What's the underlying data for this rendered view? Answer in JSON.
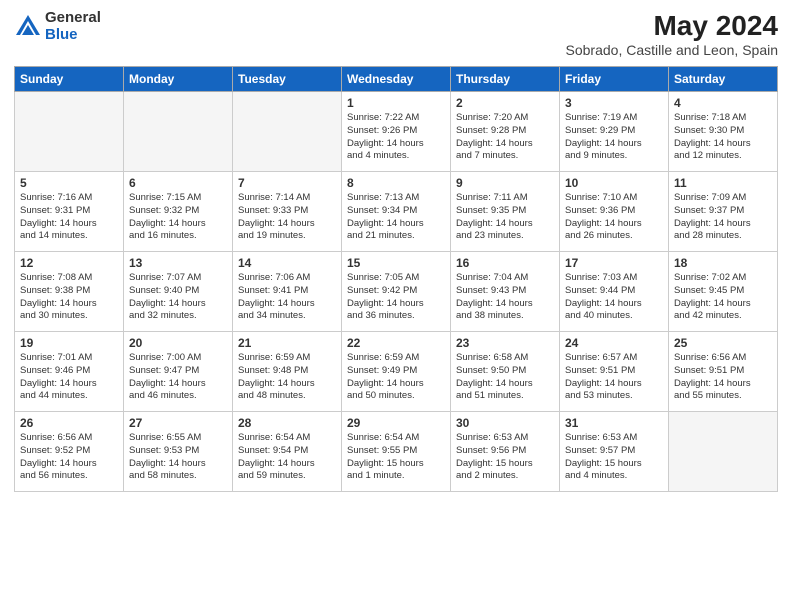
{
  "header": {
    "logo_general": "General",
    "logo_blue": "Blue",
    "month_title": "May 2024",
    "location": "Sobrado, Castille and Leon, Spain"
  },
  "weekdays": [
    "Sunday",
    "Monday",
    "Tuesday",
    "Wednesday",
    "Thursday",
    "Friday",
    "Saturday"
  ],
  "weeks": [
    [
      {
        "day": "",
        "empty": true
      },
      {
        "day": "",
        "empty": true
      },
      {
        "day": "",
        "empty": true
      },
      {
        "day": "1",
        "lines": [
          "Sunrise: 7:22 AM",
          "Sunset: 9:26 PM",
          "Daylight: 14 hours",
          "and 4 minutes."
        ]
      },
      {
        "day": "2",
        "lines": [
          "Sunrise: 7:20 AM",
          "Sunset: 9:28 PM",
          "Daylight: 14 hours",
          "and 7 minutes."
        ]
      },
      {
        "day": "3",
        "lines": [
          "Sunrise: 7:19 AM",
          "Sunset: 9:29 PM",
          "Daylight: 14 hours",
          "and 9 minutes."
        ]
      },
      {
        "day": "4",
        "lines": [
          "Sunrise: 7:18 AM",
          "Sunset: 9:30 PM",
          "Daylight: 14 hours",
          "and 12 minutes."
        ]
      }
    ],
    [
      {
        "day": "5",
        "lines": [
          "Sunrise: 7:16 AM",
          "Sunset: 9:31 PM",
          "Daylight: 14 hours",
          "and 14 minutes."
        ]
      },
      {
        "day": "6",
        "lines": [
          "Sunrise: 7:15 AM",
          "Sunset: 9:32 PM",
          "Daylight: 14 hours",
          "and 16 minutes."
        ]
      },
      {
        "day": "7",
        "lines": [
          "Sunrise: 7:14 AM",
          "Sunset: 9:33 PM",
          "Daylight: 14 hours",
          "and 19 minutes."
        ]
      },
      {
        "day": "8",
        "lines": [
          "Sunrise: 7:13 AM",
          "Sunset: 9:34 PM",
          "Daylight: 14 hours",
          "and 21 minutes."
        ]
      },
      {
        "day": "9",
        "lines": [
          "Sunrise: 7:11 AM",
          "Sunset: 9:35 PM",
          "Daylight: 14 hours",
          "and 23 minutes."
        ]
      },
      {
        "day": "10",
        "lines": [
          "Sunrise: 7:10 AM",
          "Sunset: 9:36 PM",
          "Daylight: 14 hours",
          "and 26 minutes."
        ]
      },
      {
        "day": "11",
        "lines": [
          "Sunrise: 7:09 AM",
          "Sunset: 9:37 PM",
          "Daylight: 14 hours",
          "and 28 minutes."
        ]
      }
    ],
    [
      {
        "day": "12",
        "lines": [
          "Sunrise: 7:08 AM",
          "Sunset: 9:38 PM",
          "Daylight: 14 hours",
          "and 30 minutes."
        ]
      },
      {
        "day": "13",
        "lines": [
          "Sunrise: 7:07 AM",
          "Sunset: 9:40 PM",
          "Daylight: 14 hours",
          "and 32 minutes."
        ]
      },
      {
        "day": "14",
        "lines": [
          "Sunrise: 7:06 AM",
          "Sunset: 9:41 PM",
          "Daylight: 14 hours",
          "and 34 minutes."
        ]
      },
      {
        "day": "15",
        "lines": [
          "Sunrise: 7:05 AM",
          "Sunset: 9:42 PM",
          "Daylight: 14 hours",
          "and 36 minutes."
        ]
      },
      {
        "day": "16",
        "lines": [
          "Sunrise: 7:04 AM",
          "Sunset: 9:43 PM",
          "Daylight: 14 hours",
          "and 38 minutes."
        ]
      },
      {
        "day": "17",
        "lines": [
          "Sunrise: 7:03 AM",
          "Sunset: 9:44 PM",
          "Daylight: 14 hours",
          "and 40 minutes."
        ]
      },
      {
        "day": "18",
        "lines": [
          "Sunrise: 7:02 AM",
          "Sunset: 9:45 PM",
          "Daylight: 14 hours",
          "and 42 minutes."
        ]
      }
    ],
    [
      {
        "day": "19",
        "lines": [
          "Sunrise: 7:01 AM",
          "Sunset: 9:46 PM",
          "Daylight: 14 hours",
          "and 44 minutes."
        ]
      },
      {
        "day": "20",
        "lines": [
          "Sunrise: 7:00 AM",
          "Sunset: 9:47 PM",
          "Daylight: 14 hours",
          "and 46 minutes."
        ]
      },
      {
        "day": "21",
        "lines": [
          "Sunrise: 6:59 AM",
          "Sunset: 9:48 PM",
          "Daylight: 14 hours",
          "and 48 minutes."
        ]
      },
      {
        "day": "22",
        "lines": [
          "Sunrise: 6:59 AM",
          "Sunset: 9:49 PM",
          "Daylight: 14 hours",
          "and 50 minutes."
        ]
      },
      {
        "day": "23",
        "lines": [
          "Sunrise: 6:58 AM",
          "Sunset: 9:50 PM",
          "Daylight: 14 hours",
          "and 51 minutes."
        ]
      },
      {
        "day": "24",
        "lines": [
          "Sunrise: 6:57 AM",
          "Sunset: 9:51 PM",
          "Daylight: 14 hours",
          "and 53 minutes."
        ]
      },
      {
        "day": "25",
        "lines": [
          "Sunrise: 6:56 AM",
          "Sunset: 9:51 PM",
          "Daylight: 14 hours",
          "and 55 minutes."
        ]
      }
    ],
    [
      {
        "day": "26",
        "lines": [
          "Sunrise: 6:56 AM",
          "Sunset: 9:52 PM",
          "Daylight: 14 hours",
          "and 56 minutes."
        ]
      },
      {
        "day": "27",
        "lines": [
          "Sunrise: 6:55 AM",
          "Sunset: 9:53 PM",
          "Daylight: 14 hours",
          "and 58 minutes."
        ]
      },
      {
        "day": "28",
        "lines": [
          "Sunrise: 6:54 AM",
          "Sunset: 9:54 PM",
          "Daylight: 14 hours",
          "and 59 minutes."
        ]
      },
      {
        "day": "29",
        "lines": [
          "Sunrise: 6:54 AM",
          "Sunset: 9:55 PM",
          "Daylight: 15 hours",
          "and 1 minute."
        ]
      },
      {
        "day": "30",
        "lines": [
          "Sunrise: 6:53 AM",
          "Sunset: 9:56 PM",
          "Daylight: 15 hours",
          "and 2 minutes."
        ]
      },
      {
        "day": "31",
        "lines": [
          "Sunrise: 6:53 AM",
          "Sunset: 9:57 PM",
          "Daylight: 15 hours",
          "and 4 minutes."
        ]
      },
      {
        "day": "",
        "empty": true
      }
    ]
  ]
}
